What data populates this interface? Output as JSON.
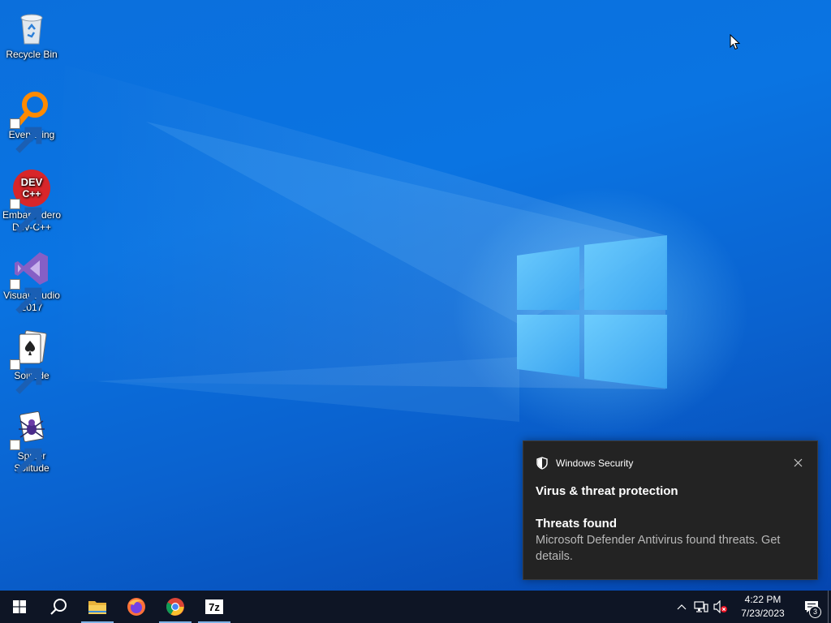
{
  "desktop": {
    "icons": [
      {
        "label": "Recycle Bin",
        "icon": "recycle-bin-icon"
      },
      {
        "label": "Everything",
        "icon": "everything-search-icon"
      },
      {
        "label": "Embarcadero Dev-C++",
        "icon": "dev-cpp-icon",
        "logo_text": "DEV C++"
      },
      {
        "label": "Visual Studio 2017",
        "icon": "visual-studio-icon"
      },
      {
        "label": "Solitude",
        "icon": "solitaire-icon"
      },
      {
        "label": "Spider Solitude",
        "icon": "spider-solitaire-icon"
      }
    ]
  },
  "toast": {
    "app_name": "Windows Security",
    "title": "Virus & threat protection",
    "subtitle": "Threats found",
    "body": "Microsoft Defender Antivirus found threats. Get details.",
    "close_icon": "close-icon"
  },
  "taskbar": {
    "items": [
      "start-icon",
      "search-icon",
      "file-explorer-icon",
      "firefox-icon",
      "chrome-icon",
      "7zip-icon"
    ],
    "seven_zip_label": "7z",
    "time": "4:22 PM",
    "date": "7/23/2023",
    "notification_count": "3"
  },
  "colors": {
    "taskbar": "#0e1525",
    "toast_bg": "#232323",
    "desktop_blue": "#0a6fdc"
  }
}
